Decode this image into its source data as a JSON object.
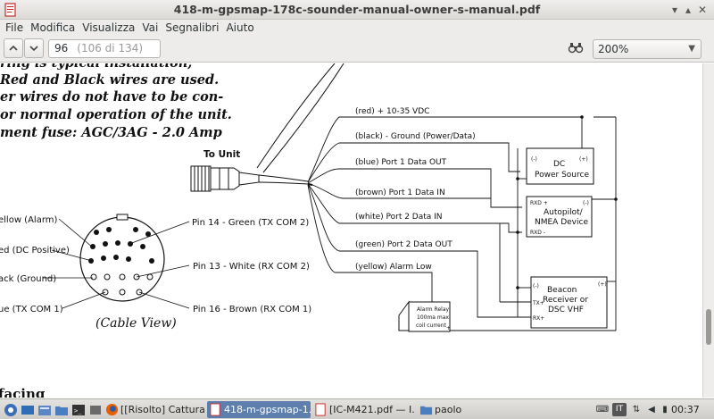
{
  "window": {
    "title": "418-m-gpsmap-178c-sounder-manual-owner-s-manual.pdf"
  },
  "menu": [
    "File",
    "Modifica",
    "Visualizza",
    "Vai",
    "Segnalibri",
    "Aiuto"
  ],
  "toolbar": {
    "page_value": "96",
    "page_total": "(106 di 134)",
    "zoom_value": "200%"
  },
  "manual_text": [
    "ring is typical installation,",
    "Red and Black wires are used.",
    "er wires do not have to be con-",
    "or normal operation of the unit.",
    "ment fuse: AGC/3AG - 2.0 Amp"
  ],
  "diagram": {
    "connector_label": "To Unit",
    "cable_view_label": "(Cable View)",
    "section_heading": "facing",
    "wire_labels": [
      "(red) + 10-35 VDC",
      "(black) - Ground (Power/Data)",
      "(blue)  Port 1 Data OUT",
      "(brown) Port 1 Data IN",
      "(white) Port 2 Data IN",
      "(green) Port 2 Data OUT",
      "(yellow) Alarm Low"
    ],
    "pins_left": [
      "ellow (Alarm)",
      "ed (DC Positive)",
      "ack (Ground)",
      "ue (TX COM 1)"
    ],
    "pins_right": [
      "Pin 14 - Green (TX COM 2)",
      "Pin 13 - White (RX COM 2)",
      "Pin 16 - Brown (RX COM 1)"
    ],
    "power_box": {
      "minus": "(-)",
      "plus": "(+)",
      "line1": "DC",
      "line2": "Power Source"
    },
    "autopilot_box": {
      "rxd_plus": "RXD +",
      "rxd_minus": "RXD -",
      "minus": "(-)",
      "line1": "Autopilot/",
      "line2": "NMEA Device"
    },
    "beacon_box": {
      "minus": "(-)",
      "plus": "(+)",
      "tx": "TX+",
      "rx": "RX+",
      "line1": "Beacon",
      "line2": "Receiver or",
      "line3": "DSC VHF"
    },
    "alarm_box": {
      "line1": "Alarm Relay",
      "line2": "100ma max",
      "line3": "coil current",
      "plus": "+"
    }
  },
  "taskbar": {
    "tasks": [
      "[[Risolto] Cattura ...",
      "418-m-gpsmap-1...",
      "[IC-M421.pdf — I...",
      "paolo"
    ],
    "tray_it": "IT",
    "clock": "00:37"
  },
  "colors": {
    "accent": "#5e7fae",
    "firefox": "#e66000",
    "doc_bg": "#ffffff"
  }
}
